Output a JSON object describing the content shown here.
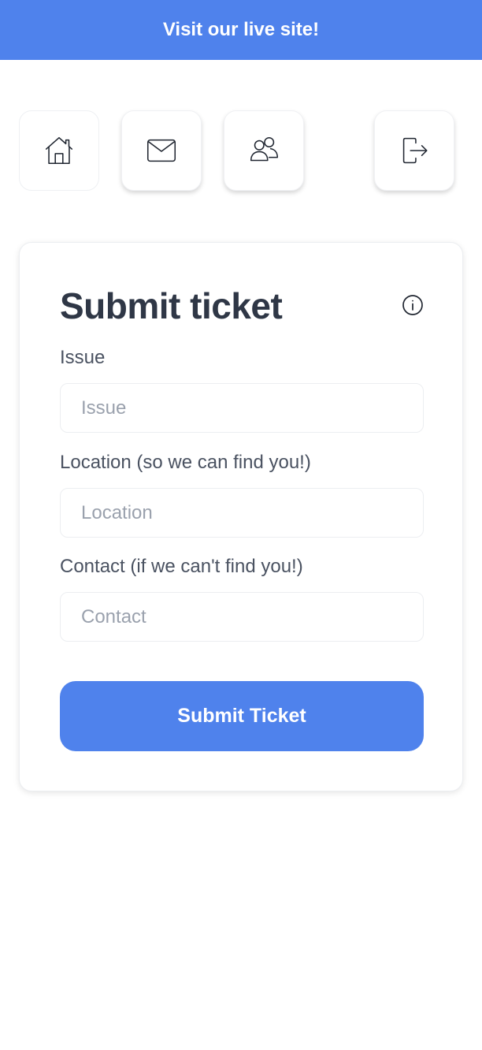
{
  "banner": {
    "text": "Visit our live site!"
  },
  "nav": {
    "items": [
      {
        "icon": "home-icon"
      },
      {
        "icon": "mail-icon"
      },
      {
        "icon": "users-icon"
      },
      {
        "icon": "logout-icon"
      }
    ]
  },
  "form": {
    "title": "Submit ticket",
    "info_icon": "info-icon",
    "fields": [
      {
        "label": "Issue",
        "placeholder": "Issue",
        "value": ""
      },
      {
        "label": "Location (so we can find you!)",
        "placeholder": "Location",
        "value": ""
      },
      {
        "label": "Contact (if we can't find you!)",
        "placeholder": "Contact",
        "value": ""
      }
    ],
    "submit_label": "Submit Ticket"
  },
  "colors": {
    "accent": "#4f82ec",
    "title_text": "#2f3746",
    "label_text": "#4a5261",
    "placeholder_text": "#9aa1ad"
  }
}
